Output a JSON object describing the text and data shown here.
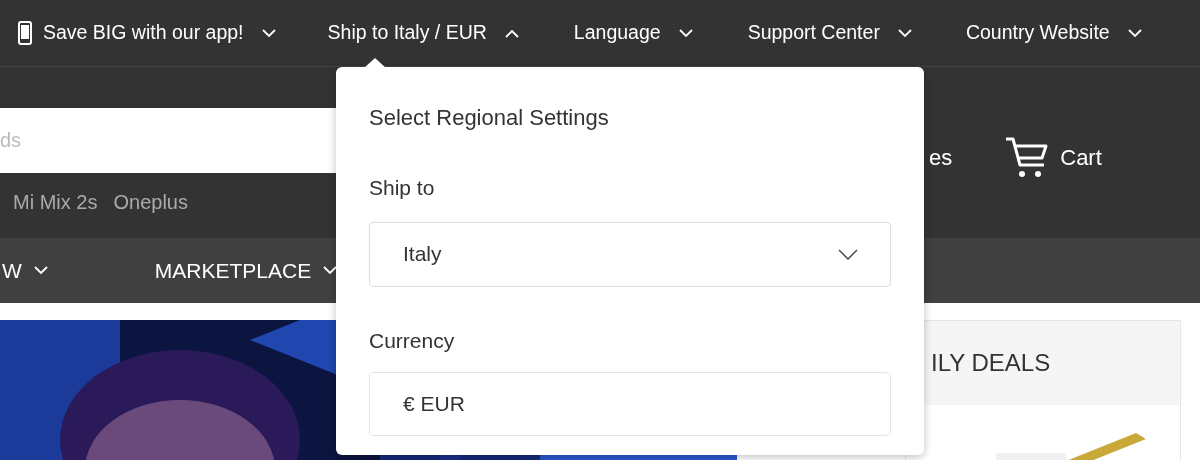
{
  "top_bar": {
    "items": [
      {
        "kind": "app",
        "label": "Save BIG with our app!",
        "expanded": false
      },
      {
        "kind": "menu",
        "label": "Ship to Italy / EUR",
        "expanded": true
      },
      {
        "kind": "menu",
        "label": "Language",
        "expanded": false
      },
      {
        "kind": "menu",
        "label": "Support Center",
        "expanded": false
      },
      {
        "kind": "menu",
        "label": "Country Website",
        "expanded": false
      }
    ]
  },
  "search": {
    "placeholder": "ds"
  },
  "suggestions": [
    "Mi Mix 2s",
    "Oneplus"
  ],
  "header_text": "es",
  "cart": {
    "label": "Cart"
  },
  "nav": [
    {
      "label": "W"
    },
    {
      "label": "MARKETPLACE"
    }
  ],
  "regional_popup": {
    "title": "Select Regional Settings",
    "ship_to": {
      "label": "Ship to",
      "value": "Italy"
    },
    "currency": {
      "label": "Currency",
      "value": "€ EUR"
    }
  },
  "daily_deals": {
    "title": "ILY DEALS"
  }
}
